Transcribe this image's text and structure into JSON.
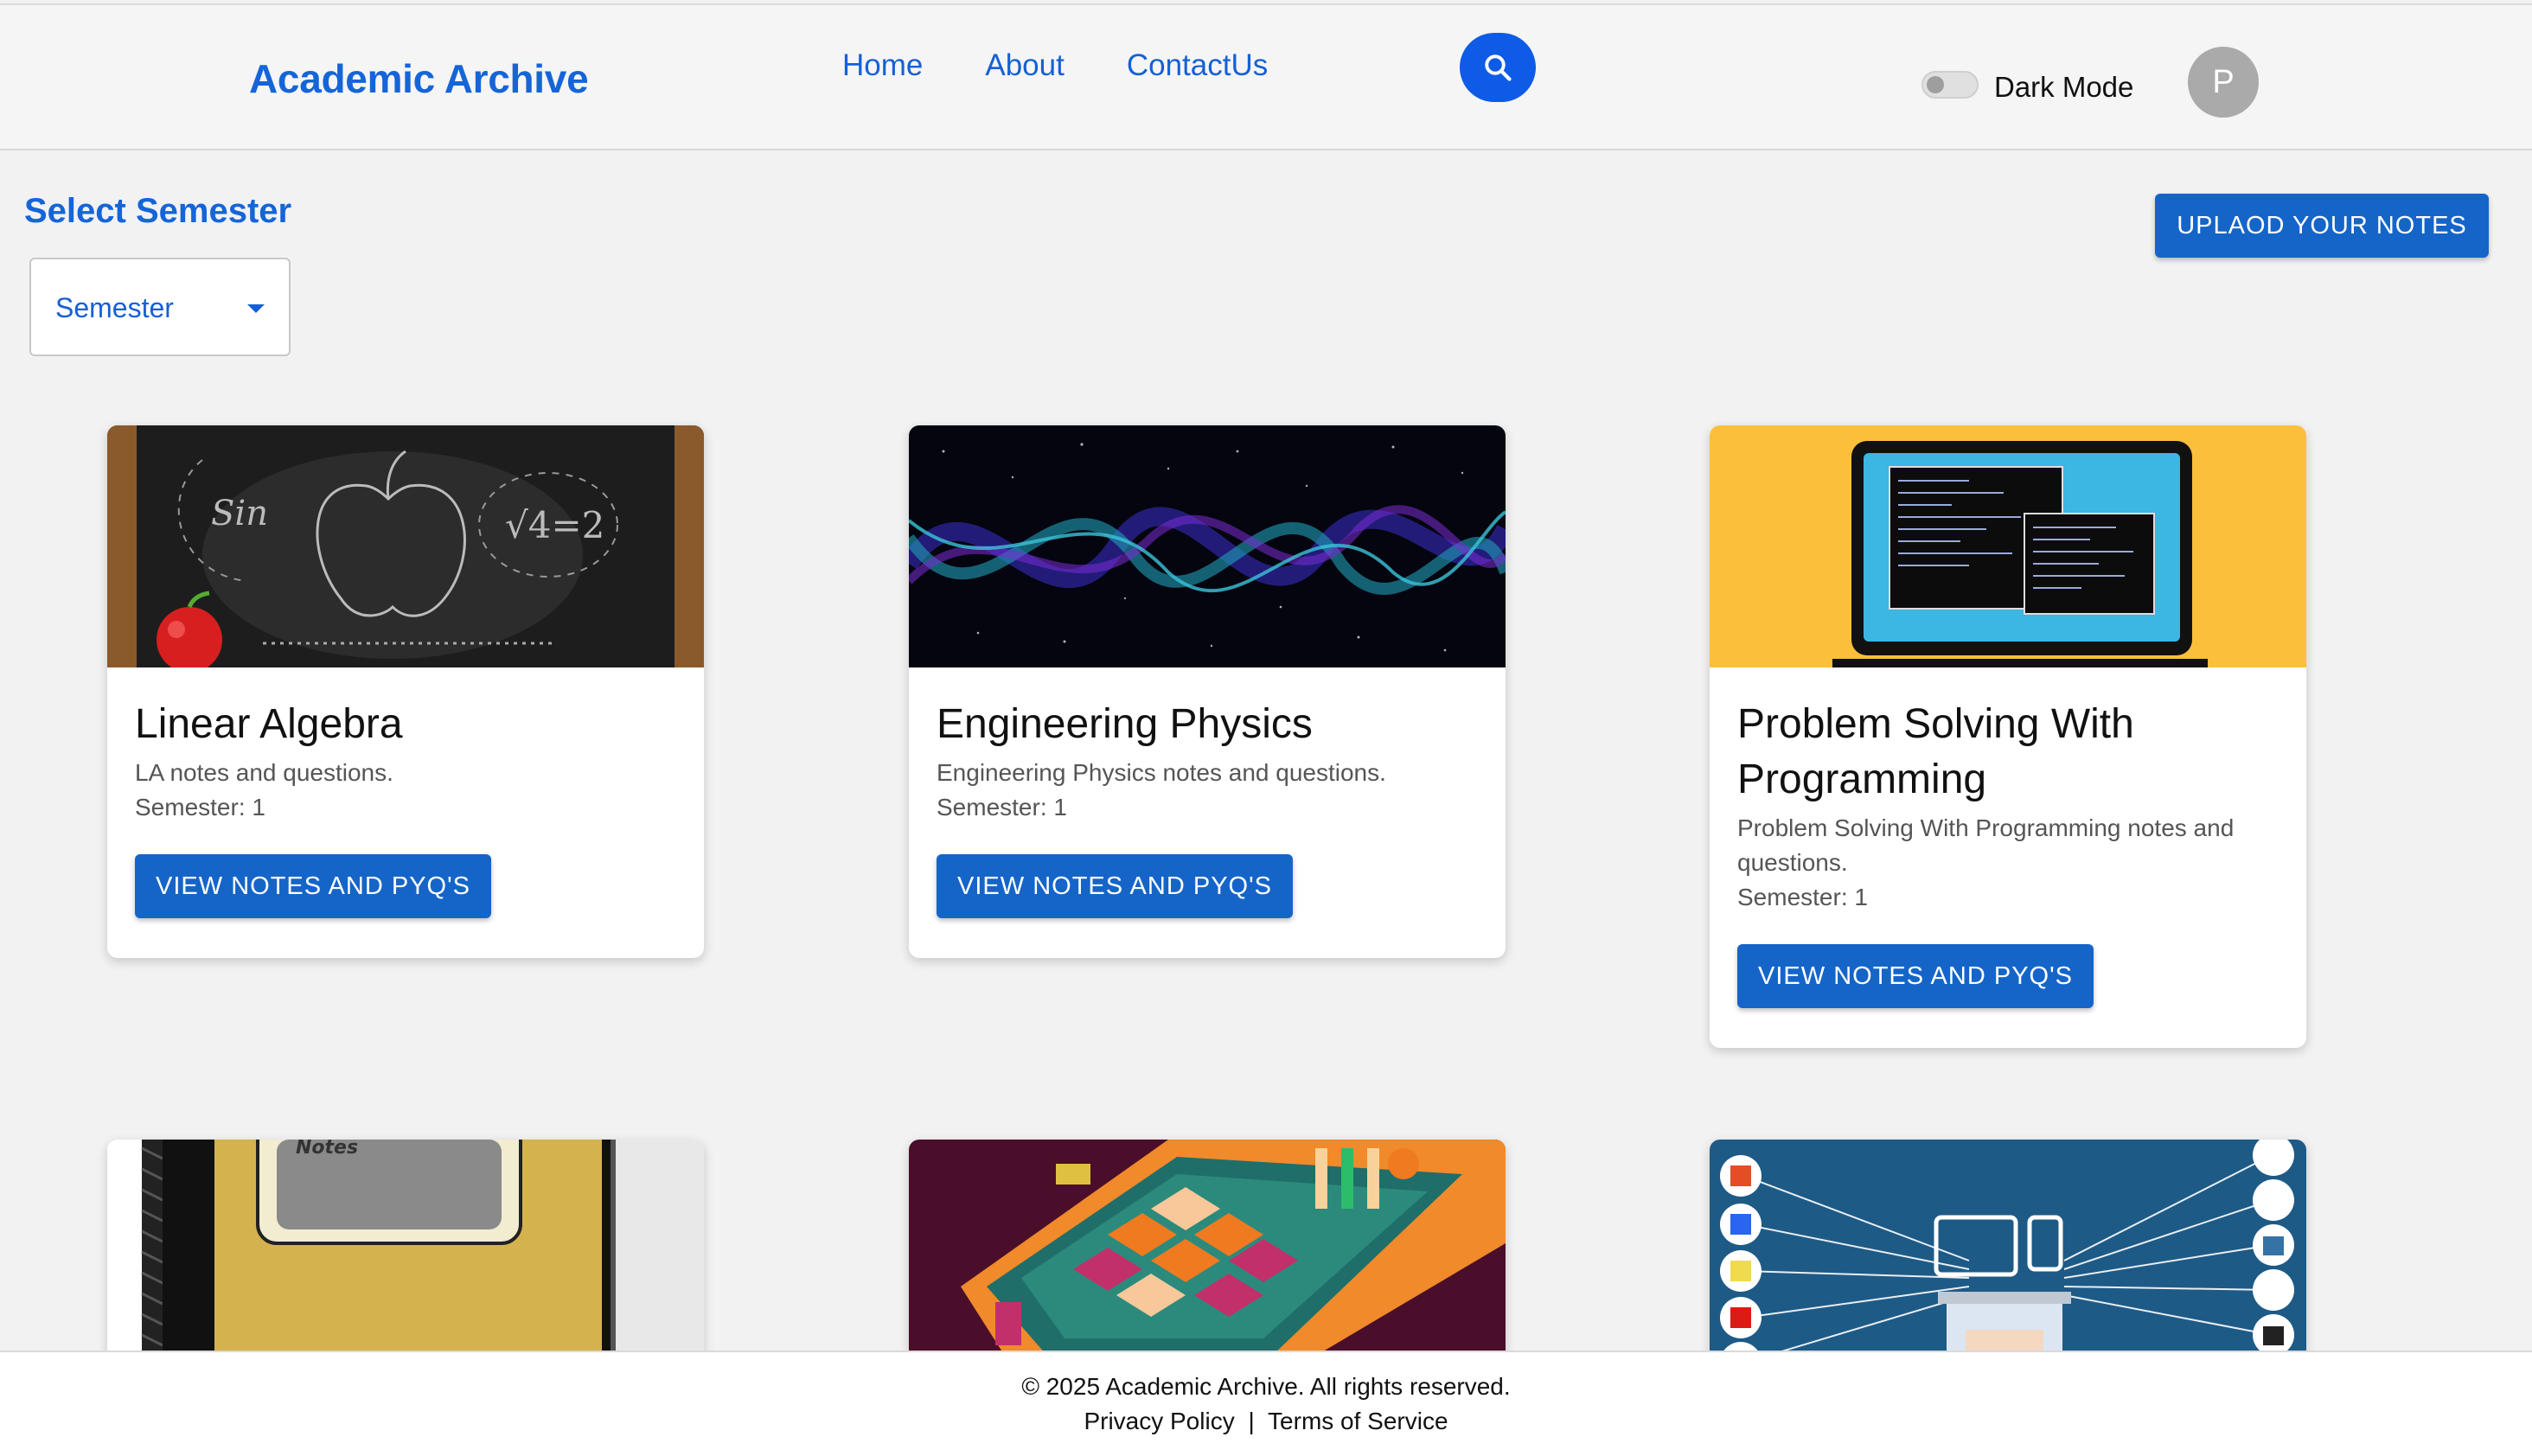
{
  "header": {
    "brand": "Academic Archive",
    "nav": [
      "Home",
      "About",
      "ContactUs"
    ],
    "dark_mode_label": "Dark Mode",
    "dark_mode_on": false,
    "avatar_initial": "P"
  },
  "toolbar": {
    "select_title": "Select Semester",
    "semester_value": "Semester",
    "upload_label": "UPLAOD YOUR NOTES"
  },
  "cards": [
    {
      "title": "Linear Algebra",
      "desc": "LA notes and questions.",
      "semester": "Semester: 1",
      "button": "VIEW NOTES AND PYQ'S",
      "image": "chalkboard-apple"
    },
    {
      "title": "Engineering Physics",
      "desc": "Engineering Physics notes and questions.",
      "semester": "Semester: 1",
      "button": "VIEW NOTES AND PYQ'S",
      "image": "cosmic-waves"
    },
    {
      "title": "Problem Solving With Programming",
      "desc": "Problem Solving With Programming notes and questions.",
      "semester": "Semester: 1",
      "button": "VIEW NOTES AND PYQ'S",
      "image": "laptop-code"
    },
    {
      "image": "notebook",
      "image_text": "Notes"
    },
    {
      "image": "isometric-keyboard"
    },
    {
      "image": "web-tech-laptop"
    }
  ],
  "footer": {
    "copyright": "© 2025 Academic Archive. All rights reserved.",
    "privacy": "Privacy Policy",
    "separator": "|",
    "terms": "Terms of Service"
  },
  "colors": {
    "brand": "#1565d8",
    "primary_button": "#1565c9",
    "search_button": "#0d5be6",
    "page_background": "#f2f2f2"
  }
}
